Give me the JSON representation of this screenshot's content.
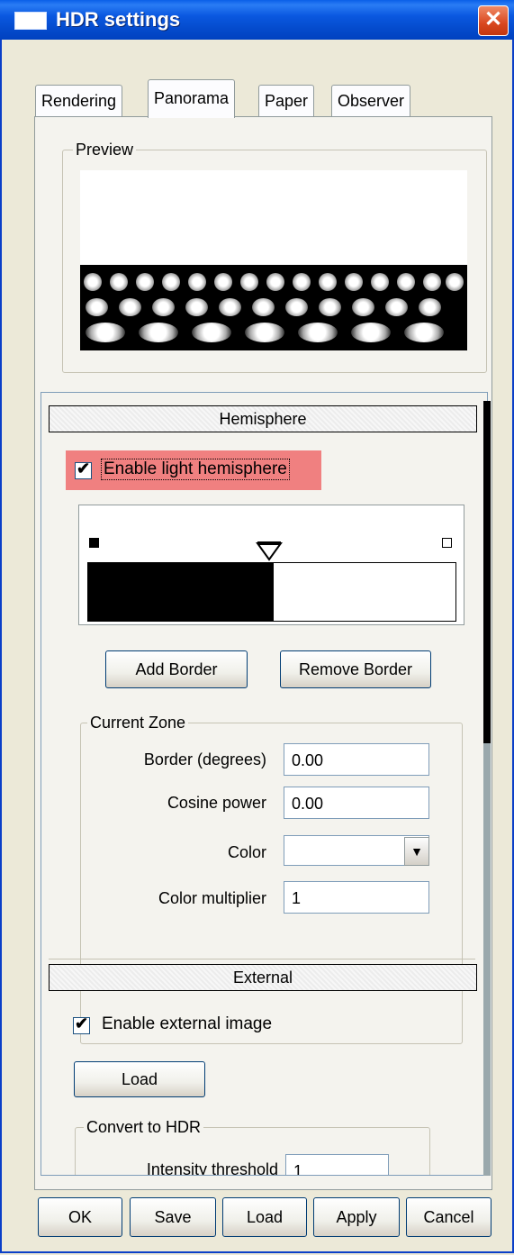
{
  "window": {
    "title": "HDR settings",
    "close_glyph": "✕"
  },
  "tabs": [
    {
      "label": "Rendering"
    },
    {
      "label": "Panorama"
    },
    {
      "label": "Paper"
    },
    {
      "label": "Observer"
    }
  ],
  "preview": {
    "group_label": "Preview"
  },
  "hemisphere": {
    "header": "Hemisphere",
    "enable_label": "Enable light hemisphere",
    "enable_checked": true,
    "add_border_label": "Add Border",
    "remove_border_label": "Remove Border",
    "current_zone": {
      "group_label": "Current Zone",
      "border_label": "Border (degrees)",
      "border_value": "0.00",
      "cosine_label": "Cosine power",
      "cosine_value": "0.00",
      "color_label": "Color",
      "color_value": "",
      "multiplier_label": "Color multiplier",
      "multiplier_value": "1"
    }
  },
  "external": {
    "header": "External",
    "enable_label": "Enable external image",
    "enable_checked": true,
    "load_label": "Load",
    "convert": {
      "group_label": "Convert to HDR",
      "threshold_label": "Intensity threshold",
      "threshold_value": "1"
    }
  },
  "footer": {
    "ok_label": "OK",
    "save_label": "Save",
    "load_label": "Load",
    "apply_label": "Apply",
    "cancel_label": "Cancel"
  },
  "colors": {
    "titlebar": "#0348c8",
    "highlight": "#f08080",
    "face": "#ece9d8"
  }
}
